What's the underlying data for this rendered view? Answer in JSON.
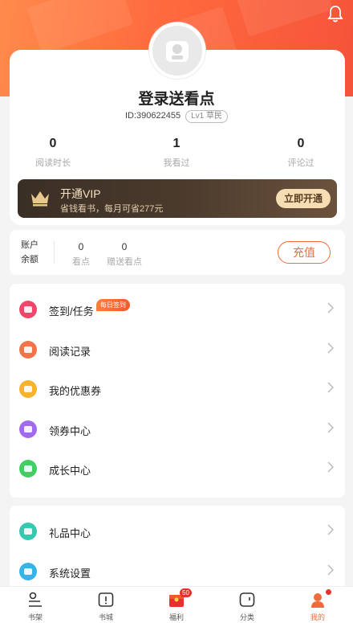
{
  "user": {
    "name": "登录送看点",
    "id_text": "ID:390622455",
    "level": "Lv1 草民"
  },
  "stats": [
    {
      "value": "0",
      "label": "阅读时长"
    },
    {
      "value": "1",
      "label": "我看过"
    },
    {
      "value": "0",
      "label": "评论过"
    }
  ],
  "vip": {
    "title": "开通VIP",
    "subtitle": "省钱看书，每月可省277元",
    "button": "立即开通"
  },
  "account": {
    "label_line1": "账户",
    "label_line2": "余额",
    "points_value": "0",
    "points_label": "看点",
    "gift_value": "0",
    "gift_label": "赠送看点",
    "recharge": "充值"
  },
  "menu1": [
    {
      "label": "签到/任务",
      "icon": "calendar-icon",
      "color": "#f0466a",
      "badge": "每日签到"
    },
    {
      "label": "阅读记录",
      "icon": "book-icon",
      "color": "#f5724a"
    },
    {
      "label": "我的优惠券",
      "icon": "coupon-icon",
      "color": "#f7b32b"
    },
    {
      "label": "领券中心",
      "icon": "ticket-icon",
      "color": "#a16bf0"
    },
    {
      "label": "成长中心",
      "icon": "star-icon",
      "color": "#3fcf63"
    }
  ],
  "menu2": [
    {
      "label": "礼品中心",
      "icon": "gift-icon",
      "color": "#36c9b0"
    },
    {
      "label": "系统设置",
      "icon": "gear-icon",
      "color": "#36b3e8"
    }
  ],
  "tabs": [
    {
      "label": "书架",
      "icon": "bookshelf-icon"
    },
    {
      "label": "书城",
      "icon": "bookstore-icon"
    },
    {
      "label": "福利",
      "icon": "welfare-icon",
      "count": "50"
    },
    {
      "label": "分类",
      "icon": "category-icon"
    },
    {
      "label": "我的",
      "icon": "profile-icon",
      "active": true
    }
  ],
  "colors": {
    "accent": "#f26b3a",
    "header": "#ff6a3d"
  }
}
